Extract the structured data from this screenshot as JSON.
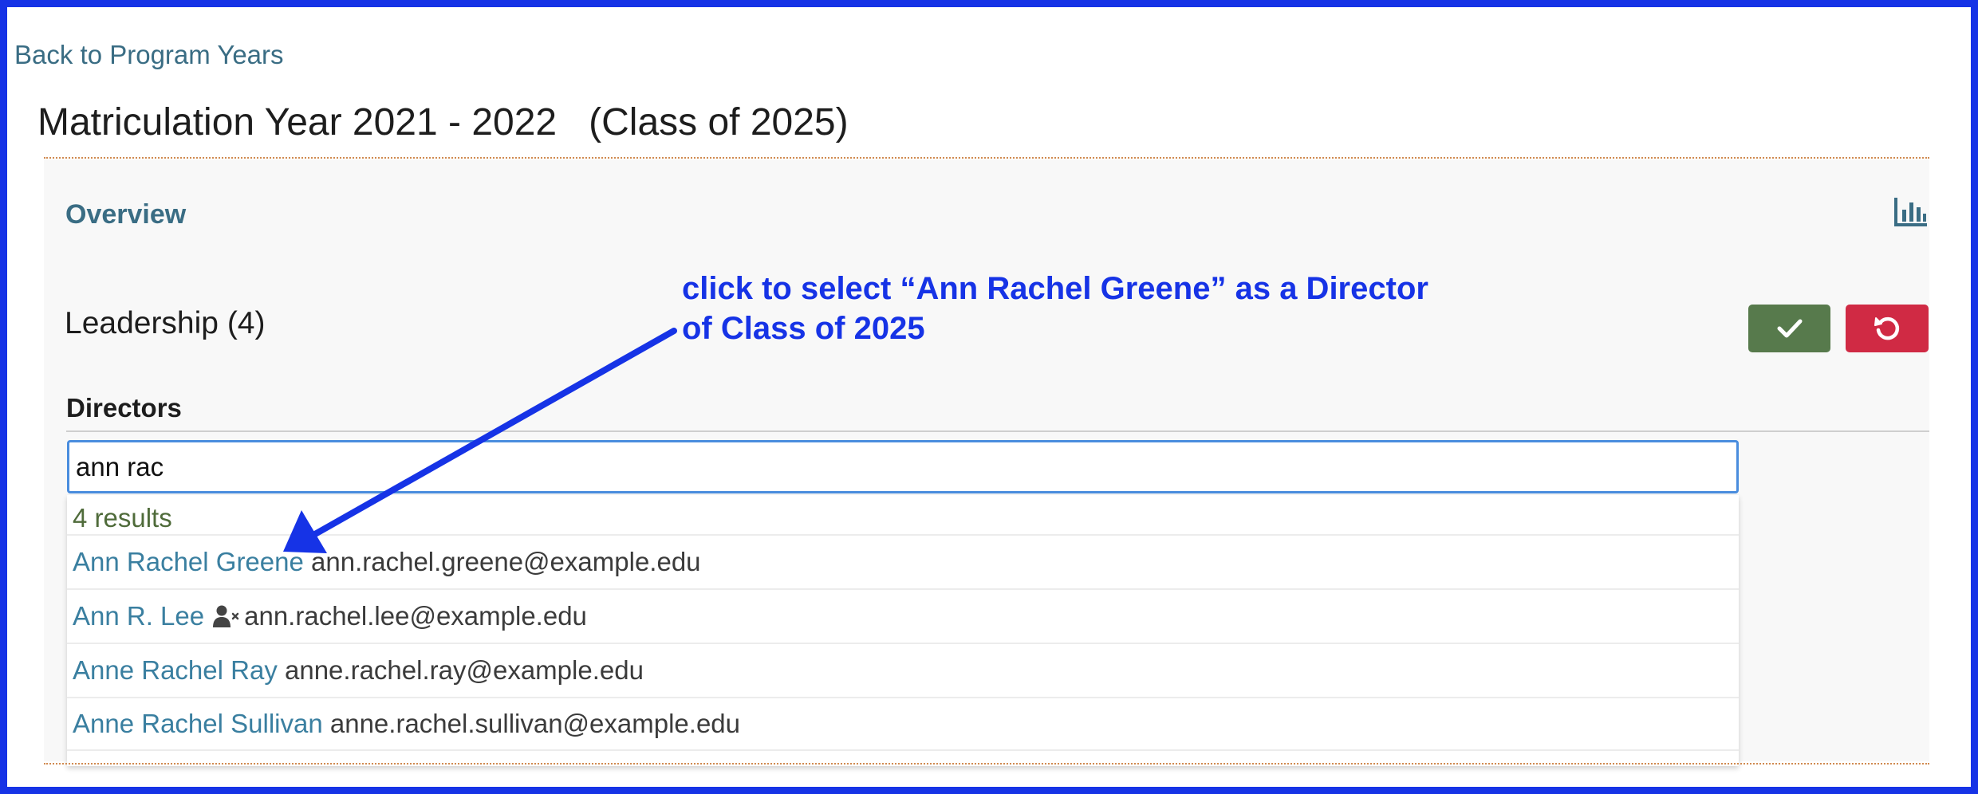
{
  "nav": {
    "back_label": "Back to Program Years"
  },
  "page": {
    "title": "Matriculation Year 2021 - 2022   (Class of 2025)"
  },
  "overview": {
    "title": "Overview",
    "chart_icon": "bar-chart-icon"
  },
  "leadership": {
    "title": "Leadership (4)",
    "save_icon": "checkmark-icon",
    "cancel_icon": "undo-icon"
  },
  "directors": {
    "label": "Directors",
    "search_value": "ann rac",
    "results_count": "4 results",
    "results": [
      {
        "name": "Ann Rachel Greene",
        "email": "ann.rachel.greene@example.edu",
        "disabled_icon": false
      },
      {
        "name": "Ann R. Lee",
        "email": "ann.rachel.lee@example.edu",
        "disabled_icon": true
      },
      {
        "name": "Anne Rachel Ray",
        "email": "anne.rachel.ray@example.edu",
        "disabled_icon": false
      },
      {
        "name": "Anne Rachel Sullivan",
        "email": "anne.rachel.sullivan@example.edu",
        "disabled_icon": false
      }
    ]
  },
  "annotation": {
    "line1": "click to select “Ann Rachel Greene” as a Director",
    "line2": "of Class of 2025",
    "color": "#1633e6"
  },
  "colors": {
    "frame": "#1633e6",
    "link": "#3a6d84",
    "save_button": "#577a4c",
    "cancel_button": "#d02a44",
    "result_name": "#3a7fa0",
    "results_count": "#4f6b3a"
  }
}
